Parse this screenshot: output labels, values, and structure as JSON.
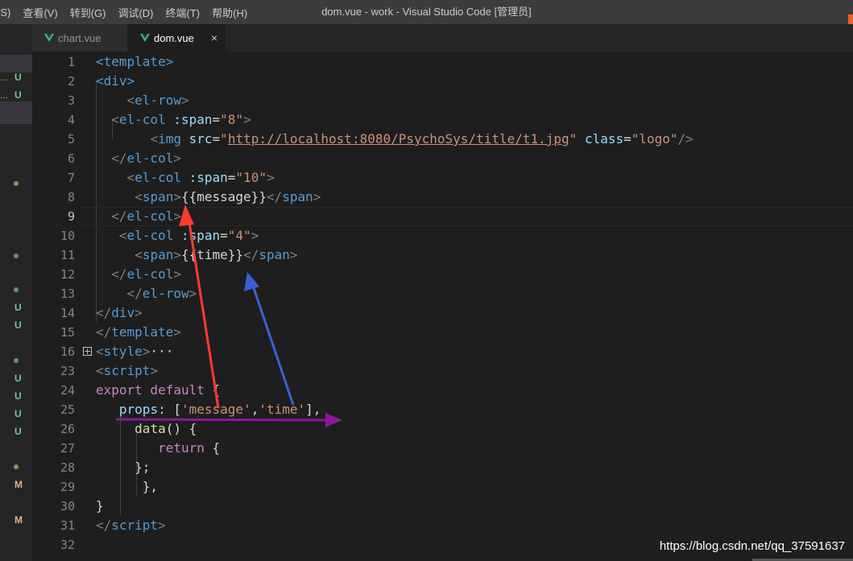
{
  "menu": [
    "(S)",
    "查看(V)",
    "转到(G)",
    "调试(D)",
    "终端(T)",
    "帮助(H)"
  ],
  "window_title": "dom.vue - work - Visual Studio Code [管理员]",
  "tabs": [
    {
      "label": "chart.vue",
      "active": false
    },
    {
      "label": "dom.vue",
      "active": true,
      "close": "×"
    }
  ],
  "sidebar": [
    {
      "prefix": "...",
      "status": "U",
      "color": "#73c991"
    },
    {
      "prefix": "...",
      "status": "U",
      "color": "#73c991"
    },
    {
      "dot": true,
      "color": "#a58a5a"
    },
    {
      "dot": true,
      "color": "#5a9a6a"
    },
    {
      "dot": true,
      "color": "#5a9a6a"
    },
    {
      "status": "U",
      "color": "#73c991"
    },
    {
      "status": "U",
      "color": "#73c991"
    },
    {
      "dot": true,
      "color": "#5a9a6a"
    },
    {
      "status": "U",
      "color": "#73c991"
    },
    {
      "status": "U",
      "color": "#73c991"
    },
    {
      "status": "U",
      "color": "#73c991"
    },
    {
      "status": "U",
      "color": "#73c991"
    },
    {
      "dot": true,
      "color": "#a58a5a"
    },
    {
      "status": "M",
      "color": "#d7ba7d"
    },
    {
      "status": "M",
      "color": "#d7ba7d"
    }
  ],
  "lines": [
    {
      "n": "1",
      "segs": [
        [
          "t",
          "<template>"
        ]
      ]
    },
    {
      "n": "2",
      "segs": [
        [
          "t",
          "<div>"
        ]
      ]
    },
    {
      "n": "3",
      "segs": [
        [
          "w",
          "    "
        ],
        [
          "p",
          "<"
        ],
        [
          "t",
          "el-row"
        ],
        [
          "p",
          ">"
        ]
      ]
    },
    {
      "n": "4",
      "segs": [
        [
          "w",
          "  "
        ],
        [
          "p",
          "<"
        ],
        [
          "t",
          "el-col"
        ],
        [
          "w",
          " "
        ],
        [
          "a",
          ":span"
        ],
        [
          "w",
          "="
        ],
        [
          "s",
          "\"8\""
        ],
        [
          "p",
          ">"
        ]
      ]
    },
    {
      "n": "5",
      "segs": [
        [
          "w",
          "       "
        ],
        [
          "p",
          "<"
        ],
        [
          "t",
          "img"
        ],
        [
          "w",
          " "
        ],
        [
          "a",
          "src"
        ],
        [
          "w",
          "="
        ],
        [
          "s",
          "\""
        ],
        [
          "u",
          "http://localhost:8080/PsychoSys/title/t1.jpg"
        ],
        [
          "s",
          "\""
        ],
        [
          "w",
          " "
        ],
        [
          "a",
          "class"
        ],
        [
          "w",
          "="
        ],
        [
          "s",
          "\"logo\""
        ],
        [
          "p",
          "/>"
        ]
      ]
    },
    {
      "n": "6",
      "segs": [
        [
          "w",
          "  "
        ],
        [
          "p",
          "</"
        ],
        [
          "t",
          "el-col"
        ],
        [
          "p",
          ">"
        ]
      ]
    },
    {
      "n": "7",
      "segs": [
        [
          "w",
          "    "
        ],
        [
          "p",
          "<"
        ],
        [
          "t",
          "el-col"
        ],
        [
          "w",
          " "
        ],
        [
          "a",
          ":span"
        ],
        [
          "w",
          "="
        ],
        [
          "s",
          "\"10\""
        ],
        [
          "p",
          ">"
        ]
      ]
    },
    {
      "n": "8",
      "segs": [
        [
          "w",
          "     "
        ],
        [
          "p",
          "<"
        ],
        [
          "t",
          "span"
        ],
        [
          "p",
          ">"
        ],
        [
          "g",
          "{{message}}"
        ],
        [
          "p",
          "</"
        ],
        [
          "t",
          "span"
        ],
        [
          "p",
          ">"
        ]
      ]
    },
    {
      "n": "9",
      "segs": [
        [
          "w",
          "  "
        ],
        [
          "p",
          "</"
        ],
        [
          "t",
          "el-col"
        ],
        [
          "p",
          ">"
        ]
      ]
    },
    {
      "n": "10",
      "segs": [
        [
          "w",
          "   "
        ],
        [
          "p",
          "<"
        ],
        [
          "t",
          "el-col"
        ],
        [
          "w",
          " "
        ],
        [
          "a",
          ":span"
        ],
        [
          "w",
          "="
        ],
        [
          "s",
          "\"4\""
        ],
        [
          "p",
          ">"
        ]
      ]
    },
    {
      "n": "11",
      "segs": [
        [
          "w",
          "     "
        ],
        [
          "p",
          "<"
        ],
        [
          "t",
          "span"
        ],
        [
          "p",
          ">"
        ],
        [
          "g",
          "{{time}}"
        ],
        [
          "p",
          "</"
        ],
        [
          "t",
          "span"
        ],
        [
          "p",
          ">"
        ]
      ]
    },
    {
      "n": "12",
      "segs": [
        [
          "w",
          "  "
        ],
        [
          "p",
          "</"
        ],
        [
          "t",
          "el-col"
        ],
        [
          "p",
          ">"
        ]
      ]
    },
    {
      "n": "13",
      "segs": [
        [
          "w",
          "    "
        ],
        [
          "p",
          "</"
        ],
        [
          "t",
          "el-row"
        ],
        [
          "p",
          ">"
        ]
      ]
    },
    {
      "n": "14",
      "segs": [
        [
          "p",
          "</"
        ],
        [
          "t",
          "div"
        ],
        [
          "p",
          ">"
        ]
      ]
    },
    {
      "n": "15",
      "segs": [
        [
          "p",
          "</"
        ],
        [
          "t",
          "template"
        ],
        [
          "p",
          ">"
        ]
      ]
    },
    {
      "n": "16",
      "segs": [
        [
          "p",
          "<"
        ],
        [
          "t",
          "style"
        ],
        [
          "p",
          ">"
        ],
        [
          "g",
          "···"
        ]
      ]
    },
    {
      "n": "23",
      "segs": [
        [
          "p",
          "<"
        ],
        [
          "t",
          "script"
        ],
        [
          "p",
          ">"
        ]
      ]
    },
    {
      "n": "24",
      "segs": [
        [
          "k",
          "export default"
        ],
        [
          "w",
          " {"
        ]
      ]
    },
    {
      "n": "25",
      "segs": [
        [
          "w",
          "   "
        ],
        [
          "a",
          "props"
        ],
        [
          "w",
          ": ["
        ],
        [
          "s",
          "'message'"
        ],
        [
          "w",
          ","
        ],
        [
          "s",
          "'time'"
        ],
        [
          "w",
          "],"
        ]
      ]
    },
    {
      "n": "26",
      "segs": [
        [
          "w",
          "     "
        ],
        [
          "f",
          "data"
        ],
        [
          "w",
          "() {"
        ]
      ]
    },
    {
      "n": "27",
      "segs": [
        [
          "w",
          "        "
        ],
        [
          "k",
          "return"
        ],
        [
          "w",
          " {"
        ]
      ]
    },
    {
      "n": "28",
      "segs": [
        [
          "w",
          "     "
        ],
        [
          "w",
          "};"
        ]
      ]
    },
    {
      "n": "29",
      "segs": [
        [
          "w",
          "      "
        ],
        [
          "w",
          "},"
        ]
      ]
    },
    {
      "n": "30",
      "segs": [
        [
          "w",
          "}"
        ]
      ]
    },
    {
      "n": "31",
      "segs": [
        [
          "p",
          "</"
        ],
        [
          "t",
          "script"
        ],
        [
          "p",
          ">"
        ]
      ]
    },
    {
      "n": "32",
      "segs": []
    }
  ],
  "active_line": "9",
  "folded_line": "16",
  "fold_glyph": "+",
  "watermark": "https://blog.csdn.net/qq_37591637",
  "colors": {
    "tag": "#569cd6",
    "attr": "#9cdcfe",
    "string": "#ce9178",
    "keyword": "#c586c0",
    "function": "#dcdcaa",
    "arrow_red": "#ff3b30",
    "arrow_blue": "#3c5fd6",
    "arrow_purple": "#8a1a9a"
  }
}
